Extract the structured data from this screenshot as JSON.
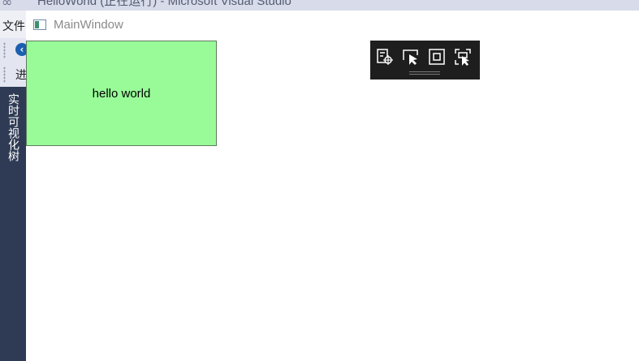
{
  "vs": {
    "title": "HelloWorld (正在运行) - Microsoft Visual Studio",
    "menu_file": "文件",
    "toolbar_process": "进",
    "sidebar_tab": "实时可视化树"
  },
  "app": {
    "title": "MainWindow",
    "content_text": "hello world",
    "content_bg": "#98FB98"
  },
  "debug_toolbar": {
    "buttons": [
      "go-to-live-visual-tree-icon",
      "select-element-icon",
      "display-layout-adorners-icon",
      "track-focused-element-icon"
    ]
  }
}
